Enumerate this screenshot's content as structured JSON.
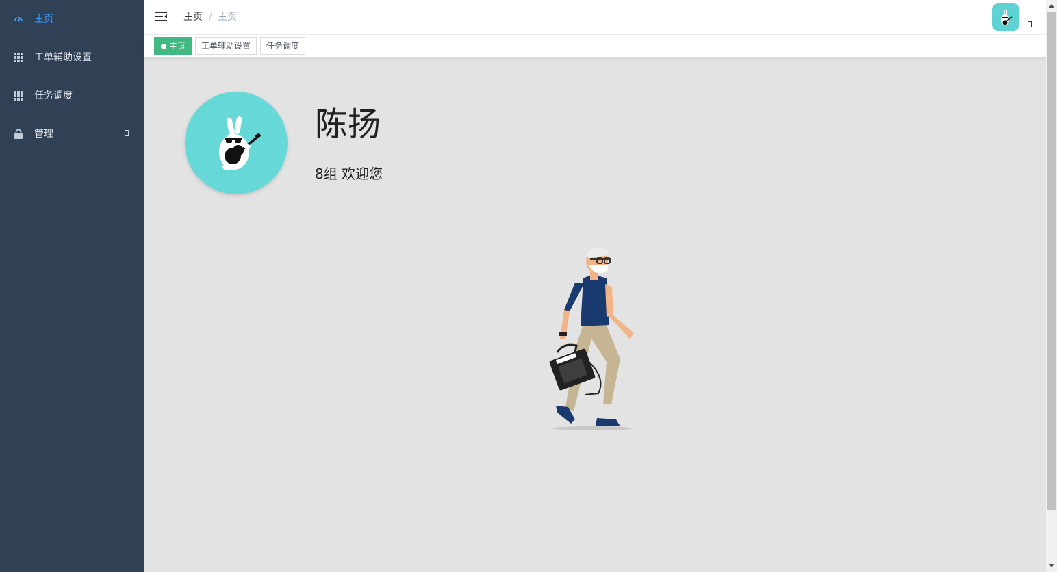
{
  "sidebar": {
    "items": [
      {
        "label": "主页",
        "icon": "dashboard-icon",
        "active": true
      },
      {
        "label": "工单辅助设置",
        "icon": "table-icon",
        "active": false
      },
      {
        "label": "任务调度",
        "icon": "table-icon",
        "active": false
      },
      {
        "label": "管理",
        "icon": "lock-icon",
        "active": false,
        "has_submenu": true
      }
    ]
  },
  "navbar": {
    "breadcrumb": [
      "主页",
      "主页"
    ],
    "separator": "/"
  },
  "tags": [
    {
      "label": "主页",
      "active": true
    },
    {
      "label": "工单辅助设置",
      "active": false
    },
    {
      "label": "任务调度",
      "active": false
    }
  ],
  "dashboard": {
    "user_name": "陈扬",
    "welcome": "8组 欢迎您"
  },
  "colors": {
    "sidebar_bg": "#304156",
    "sidebar_active_text": "#409eff",
    "tag_active": "#42b983",
    "avatar_bg": "#66d8d8",
    "main_bg": "#e3e3e3"
  }
}
